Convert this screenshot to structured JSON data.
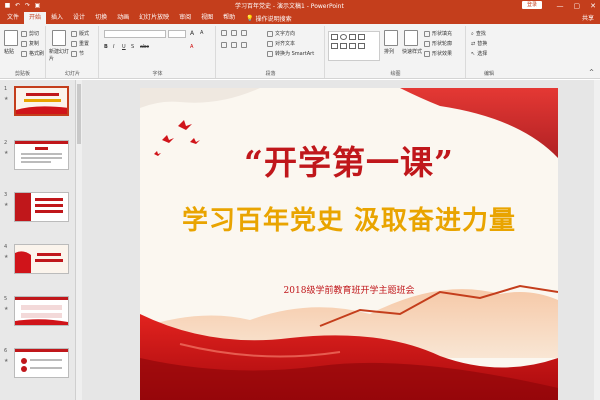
{
  "window": {
    "title": "学习百年党史 - 演示文稿1",
    "app": "PowerPoint",
    "login_label": "登录",
    "minimize": "—",
    "restore": "▢",
    "close": "✕"
  },
  "qat": [
    "save-icon",
    "undo-icon",
    "redo-icon",
    "present-icon"
  ],
  "tabs": [
    {
      "label": "文件"
    },
    {
      "label": "开始"
    },
    {
      "label": "插入"
    },
    {
      "label": "设计"
    },
    {
      "label": "切换"
    },
    {
      "label": "动画"
    },
    {
      "label": "幻灯片放映"
    },
    {
      "label": "审阅"
    },
    {
      "label": "视图"
    },
    {
      "label": "帮助"
    }
  ],
  "tell_me": "操作说明搜索",
  "share": "共享",
  "ribbon": {
    "clipboard": {
      "label": "剪贴板",
      "paste": "粘贴",
      "cut": "剪切",
      "copy": "复制",
      "format_painter": "格式刷"
    },
    "slides": {
      "label": "幻灯片",
      "new_slide": "新建幻灯片",
      "layout": "版式",
      "reset": "重置",
      "section": "节"
    },
    "font": {
      "label": "字体"
    },
    "paragraph": {
      "label": "段落",
      "text_direction": "文字方向",
      "align_text": "对齐文本",
      "smartart": "转换为 SmartArt"
    },
    "drawing": {
      "label": "绘图",
      "arrange": "排列",
      "quick_styles": "快速样式",
      "shape_fill": "形状填充",
      "shape_outline": "形状轮廓",
      "shape_effects": "形状效果"
    },
    "editing": {
      "label": "编辑",
      "find": "查找",
      "replace": "替换",
      "select": "选择"
    }
  },
  "thumbnails": [
    {
      "number": "1",
      "star": "★",
      "title": "“开学第一课”",
      "sub": "学习百年党史 汲取奋进力量"
    },
    {
      "number": "2",
      "star": "★",
      "title": "目录"
    },
    {
      "number": "3",
      "star": "★",
      "title": "目录"
    },
    {
      "number": "4",
      "star": "★",
      "title": "第一部分"
    },
    {
      "number": "5",
      "star": "★",
      "title": ""
    },
    {
      "number": "6",
      "star": "★",
      "title": ""
    }
  ],
  "slide": {
    "title": "“开学第一课”",
    "subtitle": "学习百年党史  汲取奋进力量",
    "caption": "2018级学前教育班开学主题班会"
  },
  "colors": {
    "brand": "#c43e1c",
    "slide_title": "#c0171b",
    "slide_sub": "#e9a400"
  }
}
